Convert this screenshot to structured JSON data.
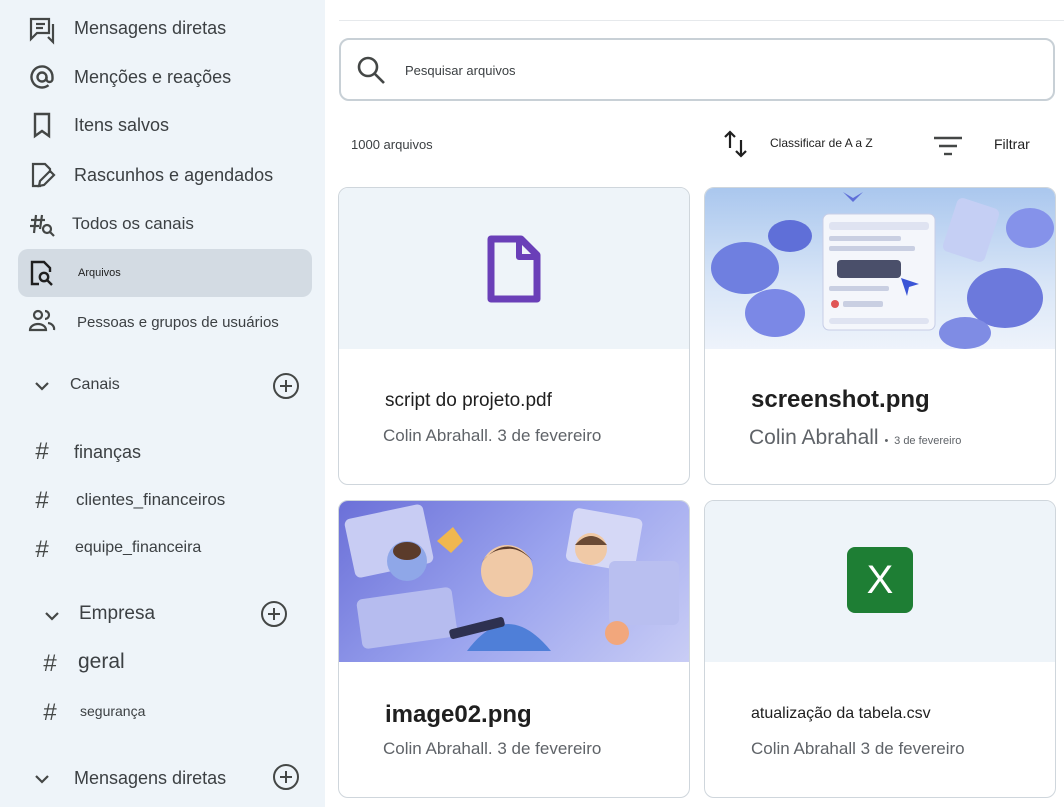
{
  "sidebar": {
    "nav": [
      {
        "label": "Mensagens diretas",
        "icon": "direct-messages-icon"
      },
      {
        "label": "Menções e reações",
        "icon": "at-sign-icon"
      },
      {
        "label": "Itens salvos",
        "icon": "bookmark-icon"
      },
      {
        "label": "Rascunhos e agendados",
        "icon": "draft-edit-icon"
      },
      {
        "label": "Todos os canais",
        "icon": "hash-search-icon"
      },
      {
        "label": "Arquivos",
        "icon": "file-search-icon",
        "active": true
      },
      {
        "label": "Pessoas e grupos de usuários",
        "icon": "people-icon"
      }
    ],
    "sections": {
      "canais": {
        "label": "Canais",
        "channels": [
          "finanças",
          "clientes_financeiros",
          "equipe_financeira"
        ]
      },
      "empresa": {
        "label": "Empresa",
        "channels": [
          "geral",
          "segurança"
        ]
      },
      "mensagens": {
        "label": "Mensagens diretas"
      }
    },
    "hash_symbol": "#"
  },
  "main": {
    "search": {
      "placeholder": "Pesquisar arquivos",
      "value": ""
    },
    "count_label": "1000 arquivos",
    "sort_label": "Classificar de A a Z",
    "filter_label": "Filtrar",
    "files": [
      {
        "name": "script do projeto.pdf",
        "author": "Colin Abrahall.",
        "date": "3 de fevereiro",
        "kind": "pdf"
      },
      {
        "name": "screenshot.png",
        "author": "Colin Abrahall",
        "separator": "•",
        "date": "3 de fevereiro",
        "kind": "image"
      },
      {
        "name": "image02.png",
        "author": "Colin Abrahall.",
        "date": "3 de fevereiro",
        "kind": "image"
      },
      {
        "name": "atualização da tabela.csv",
        "author": "Colin Abrahall",
        "date": "3 de fevereiro",
        "kind": "sheet",
        "sheet_letter": "X"
      }
    ]
  },
  "colors": {
    "sidebar_bg": "#eef4f9",
    "active_item_bg": "#d3dbe3",
    "pdf_purple": "#6a3fb8",
    "sheet_green": "#1e7e34",
    "image_blue": "#6f7fe0"
  }
}
